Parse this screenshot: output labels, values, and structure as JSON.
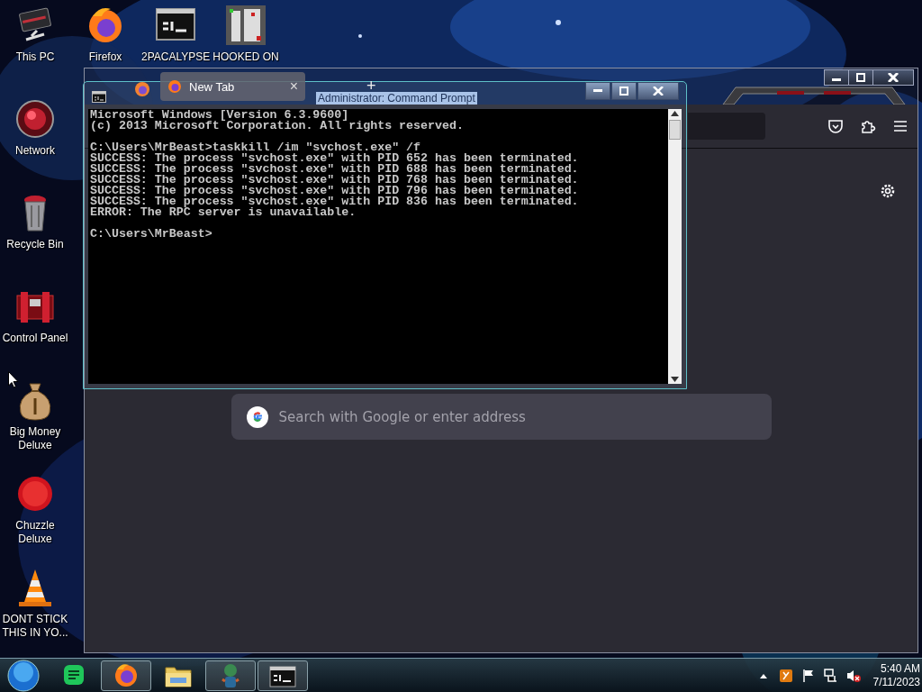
{
  "desktop_icons": [
    {
      "label": "This PC",
      "kind": "pc"
    },
    {
      "label": "Firefox",
      "kind": "browser"
    },
    {
      "label": "2PACALYPSE",
      "kind": "console"
    },
    {
      "label": "HOOKED ON",
      "kind": "maze"
    },
    {
      "label": "Network",
      "kind": "globe"
    },
    {
      "label": "Recycle Bin",
      "kind": "bin"
    },
    {
      "label": "Control Panel",
      "kind": "panel"
    },
    {
      "label": "Big Money Deluxe",
      "kind": "bag"
    },
    {
      "label": "Chuzzle Deluxe",
      "kind": "fuzz"
    },
    {
      "label": "DONT STICK THIS IN YO...",
      "kind": "cone"
    }
  ],
  "browser": {
    "tabs": [
      {
        "label": "New Tab",
        "selected": true
      }
    ],
    "new_tab": "+",
    "close_tab": "×",
    "search": {
      "placeholder": "Search with Google or enter address"
    }
  },
  "console": {
    "title": "Administrator: Command Prompt",
    "blocks": [
      [
        "Microsoft Windows [Version 6.3.9600]",
        "(c) 2013 Microsoft Corporation. All rights reserved."
      ],
      [
        "C:\\Users\\MrBeast>taskkill /im \"svchost.exe\" /f",
        "SUCCESS: The process \"svchost.exe\" with PID 652 has been terminated.",
        "SUCCESS: The process \"svchost.exe\" with PID 688 has been terminated.",
        "SUCCESS: The process \"svchost.exe\" with PID 768 has been terminated.",
        "SUCCESS: The process \"svchost.exe\" with PID 796 has been terminated.",
        "SUCCESS: The process \"svchost.exe\" with PID 836 has been terminated.",
        "ERROR: The RPC server is unavailable."
      ],
      [
        "C:\\Users\\MrBeast>"
      ]
    ]
  },
  "taskbar": {
    "apps": [
      {
        "kind": "chat",
        "running": false
      },
      {
        "kind": "browser",
        "running": true
      },
      {
        "kind": "folder",
        "running": false
      },
      {
        "kind": "figure",
        "running": true
      },
      {
        "kind": "console",
        "running": true
      }
    ],
    "clock": {
      "time": "5:40 AM",
      "date": "7/11/2023"
    }
  }
}
